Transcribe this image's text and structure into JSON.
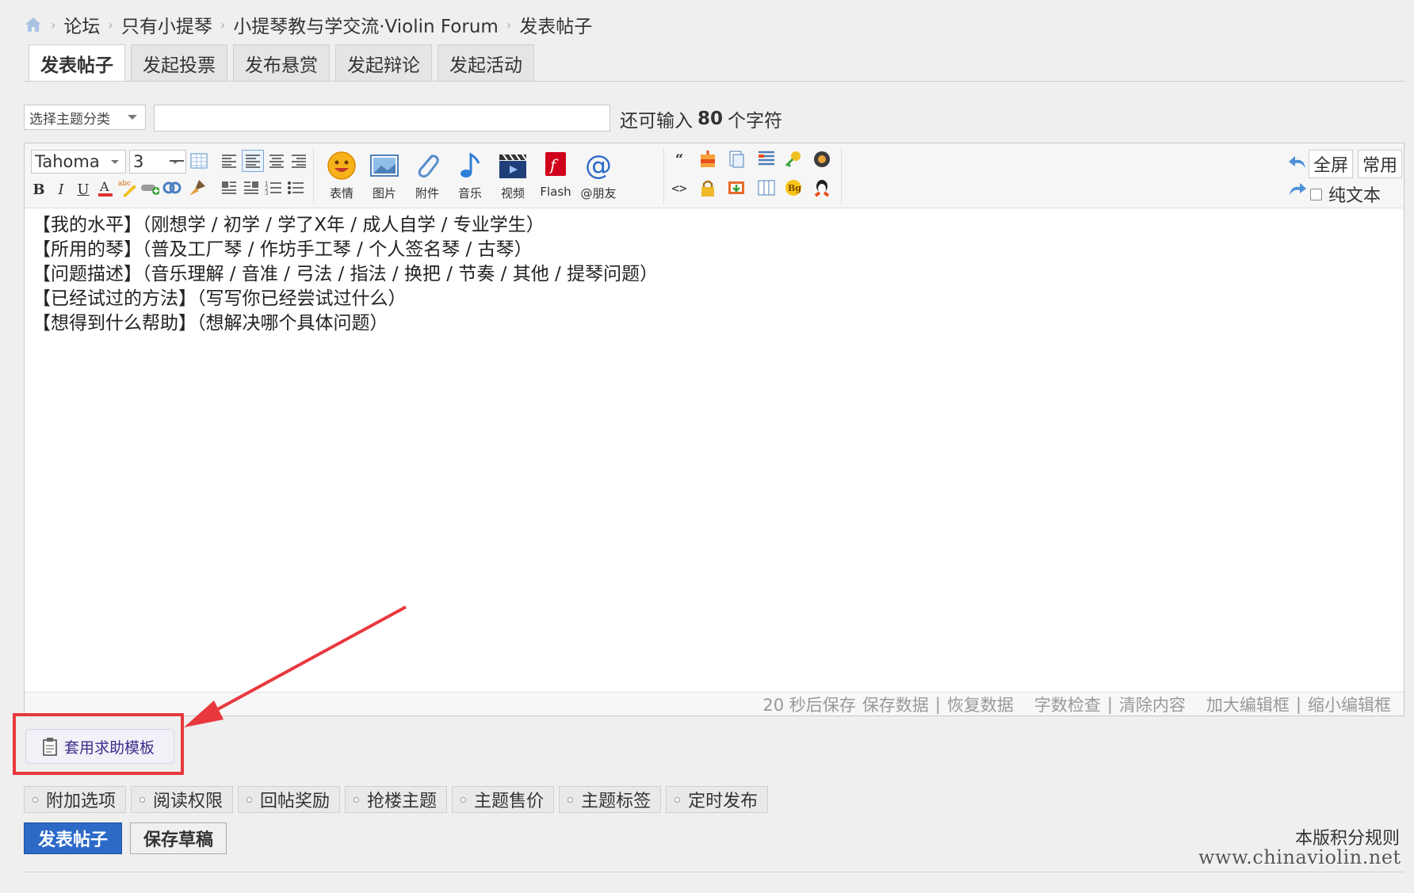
{
  "breadcrumb": {
    "items": [
      "论坛",
      "只有小提琴",
      "小提琴教与学交流·Violin Forum",
      "发表帖子"
    ]
  },
  "tabs": [
    "发表帖子",
    "发起投票",
    "发布悬赏",
    "发起辩论",
    "发起活动"
  ],
  "subject": {
    "category_placeholder": "选择主题分类",
    "counter_prefix": "还可输入",
    "counter_value": "80",
    "counter_suffix": "个字符"
  },
  "toolbar": {
    "font": "Tahoma",
    "size": "3",
    "buttons": {
      "emoji": "表情",
      "image": "图片",
      "attachment": "附件",
      "music": "音乐",
      "video": "视频",
      "flash": "Flash",
      "mention": "@朋友"
    },
    "fullscreen": "全屏",
    "common": "常用",
    "plaintext": "纯文本"
  },
  "editor": {
    "lines": [
      "【我的水平】（刚想学 / 初学 / 学了X年 / 成人自学 / 专业学生）",
      "【所用的琴】（普及工厂琴 / 作坊手工琴 / 个人签名琴 / 古琴）",
      "【问题描述】（音乐理解 / 音准 / 弓法 / 指法 / 换把 / 节奏 / 其他 / 提琴问题）",
      "【已经试过的方法】（写写你已经尝试过什么）",
      "【想得到什么帮助】（想解决哪个具体问题）"
    ],
    "footer": {
      "autosave": "20 秒后保存",
      "save": "保存数据",
      "restore": "恢复数据",
      "wordcount": "字数检查",
      "clear": "清除内容",
      "enlarge": "加大编辑框",
      "shrink": "缩小编辑框"
    }
  },
  "template_button": "套用求助模板",
  "options": [
    "附加选项",
    "阅读权限",
    "回帖奖励",
    "抢楼主题",
    "主题售价",
    "主题标签",
    "定时发布"
  ],
  "actions": {
    "submit": "发表帖子",
    "draft": "保存草稿",
    "rules": "本版积分规则"
  },
  "watermark": "www.chinaviolin.net",
  "colors": {
    "accent": "#2d6ac8",
    "highlight": "#e8383d",
    "template_text": "#3c2e8c"
  }
}
